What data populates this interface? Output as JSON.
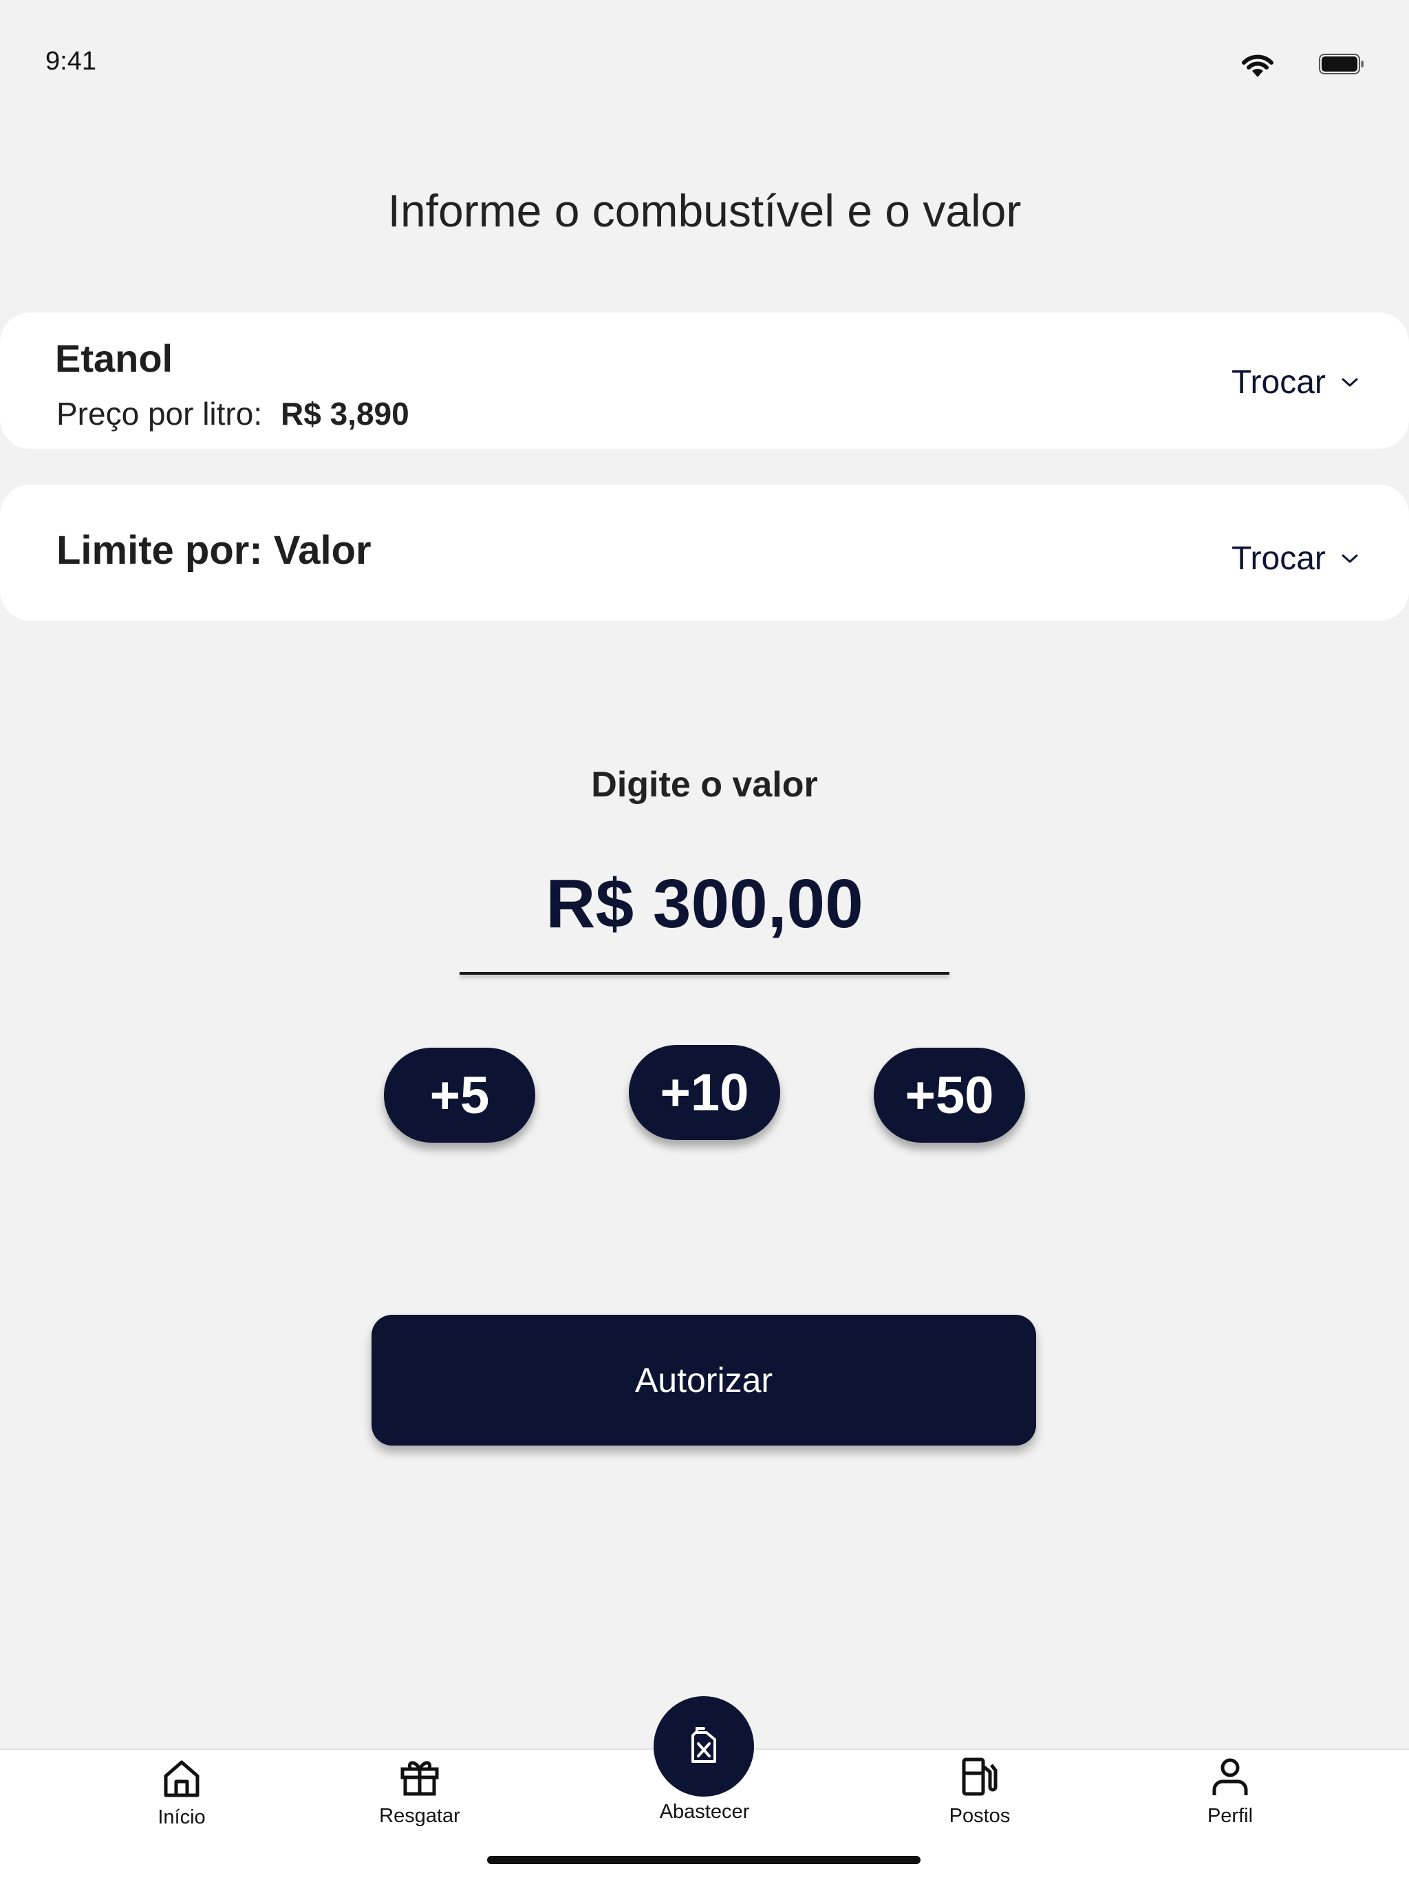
{
  "status_bar": {
    "time": "9:41",
    "wifi_icon": "wifi-icon",
    "battery_icon": "battery-icon"
  },
  "title": "Informe o combustível e o valor",
  "fuel_card": {
    "name": "Etanol",
    "price_label": "Preço por litro:",
    "price_value": "R$ 3,890",
    "swap_label": "Trocar",
    "swap_icon": "chevron-down-icon"
  },
  "limit_card": {
    "label": "Limite por: Valor",
    "swap_label": "Trocar",
    "swap_icon": "chevron-down-icon"
  },
  "amount": {
    "label": "Digite o valor",
    "value": "R$ 300,00"
  },
  "quick_add": [
    {
      "label": "+5"
    },
    {
      "label": "+10"
    },
    {
      "label": "+50"
    }
  ],
  "authorize_label": "Autorizar",
  "bottom_nav": {
    "items": [
      {
        "label": "Início",
        "icon": "home-icon"
      },
      {
        "label": "Resgatar",
        "icon": "gift-icon"
      },
      {
        "label": "Abastecer",
        "icon": "fuel-can-icon",
        "active": true
      },
      {
        "label": "Postos",
        "icon": "gas-station-icon"
      },
      {
        "label": "Perfil",
        "icon": "user-icon"
      }
    ]
  },
  "colors": {
    "primary": "#0d1433",
    "background": "#f2f2f2",
    "card": "#ffffff",
    "text": "#1f1f1f"
  }
}
